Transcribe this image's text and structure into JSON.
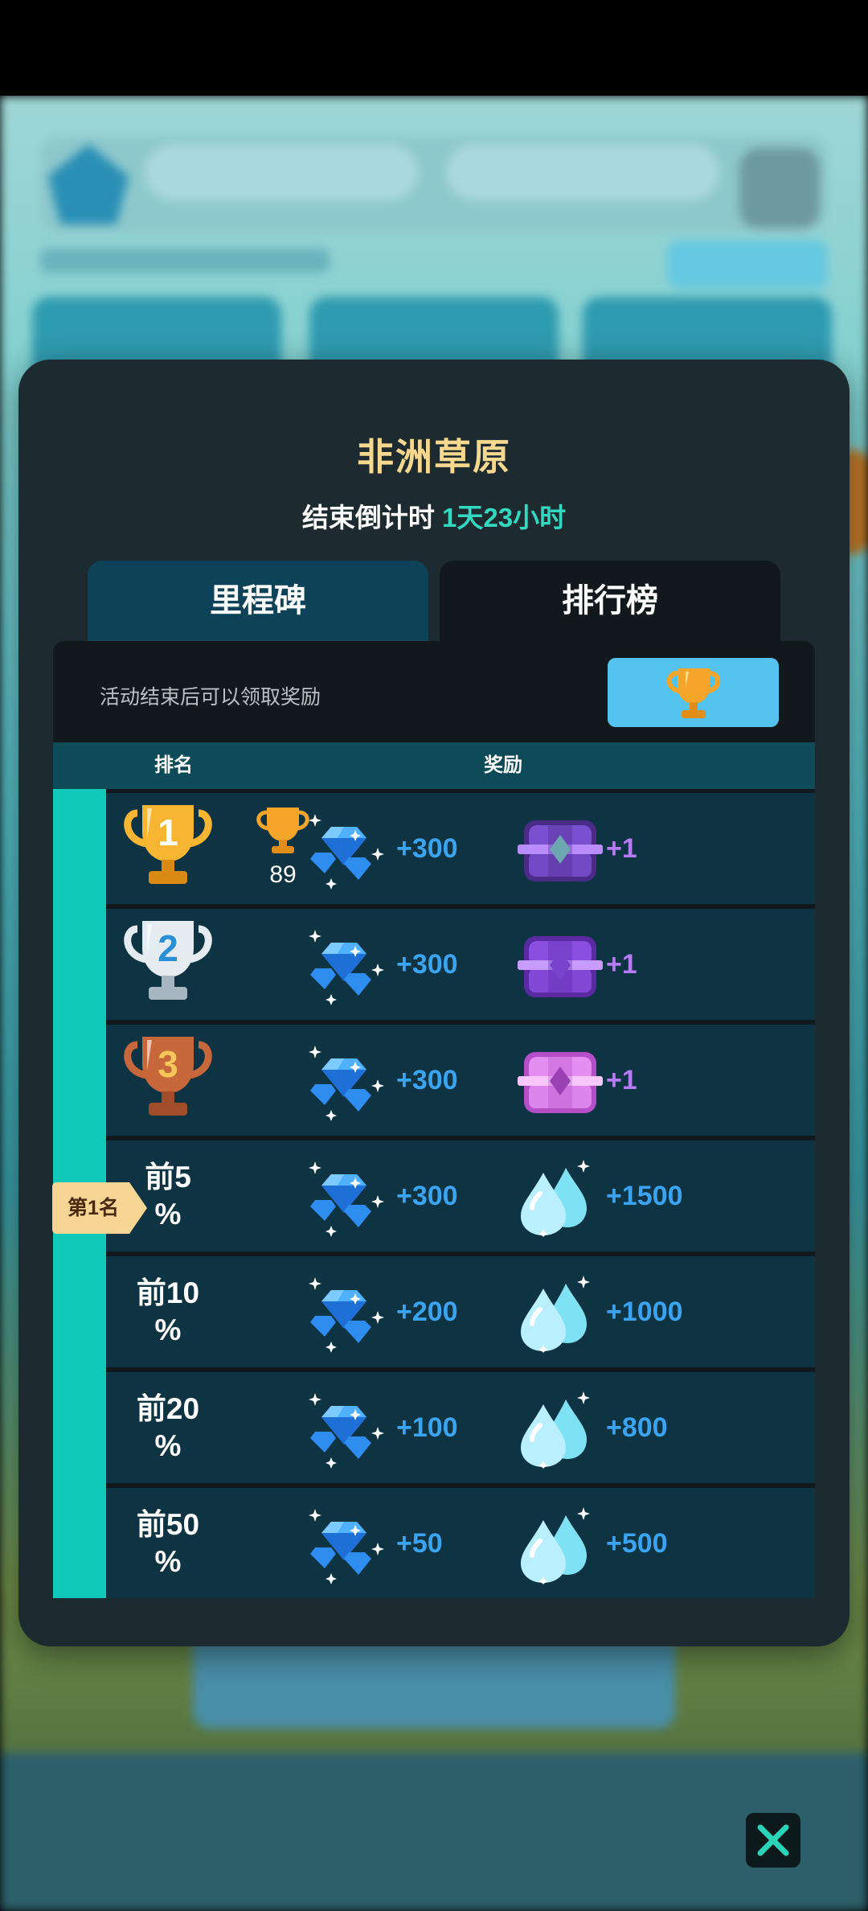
{
  "event": {
    "title": "非洲草原",
    "countdown_label": "结束倒计时",
    "countdown_value": "1天23小时"
  },
  "tabs": [
    {
      "label": "里程碑",
      "active": false
    },
    {
      "label": "排行榜",
      "active": true
    }
  ],
  "panel": {
    "note": "活动结束后可以领取奖励",
    "claim_icon": "trophy-icon"
  },
  "table": {
    "rank_header": "排名",
    "reward_header": "奖励",
    "current_rank_badge": "第1名",
    "my_score": "89",
    "rows": [
      {
        "rank": "1",
        "rank_icon": "gold-trophy-icon",
        "gem_amount": "+300",
        "item_icon": "legendary-chest-icon",
        "item_amount": "+1",
        "item_type": "chest"
      },
      {
        "rank": "2",
        "rank_icon": "silver-trophy-icon",
        "gem_amount": "+300",
        "item_icon": "epic-chest-icon",
        "item_amount": "+1",
        "item_type": "chest"
      },
      {
        "rank": "3",
        "rank_icon": "bronze-trophy-icon",
        "gem_amount": "+300",
        "item_icon": "rare-chest-icon",
        "item_amount": "+1",
        "item_type": "chest"
      },
      {
        "rank_line1": "前5",
        "rank_line2": "%",
        "gem_amount": "+300",
        "item_icon": "water-drop-icon",
        "item_amount": "+1500",
        "item_type": "drop"
      },
      {
        "rank_line1": "前10",
        "rank_line2": "%",
        "gem_amount": "+200",
        "item_icon": "water-drop-icon",
        "item_amount": "+1000",
        "item_type": "drop"
      },
      {
        "rank_line1": "前20",
        "rank_line2": "%",
        "gem_amount": "+100",
        "item_icon": "water-drop-icon",
        "item_amount": "+800",
        "item_type": "drop"
      },
      {
        "rank_line1": "前50",
        "rank_line2": "%",
        "gem_amount": "+50",
        "item_icon": "water-drop-icon",
        "item_amount": "+500",
        "item_type": "drop"
      }
    ]
  },
  "colors": {
    "title": "#f6d88e",
    "countdown": "#32d8c0",
    "gem_text": "#3aa4f0",
    "chest_text": "#b57bf3",
    "rank_bar": "#12c9b9"
  }
}
